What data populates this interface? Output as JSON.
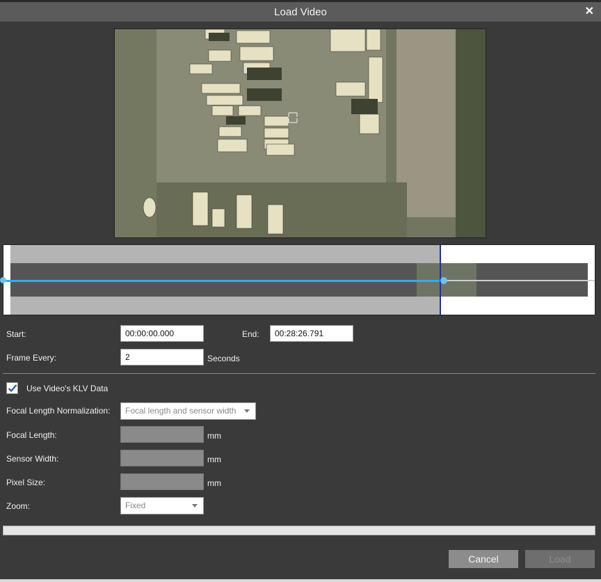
{
  "dialog": {
    "title": "Load Video",
    "close_label": "✕"
  },
  "form": {
    "start_label": "Start:",
    "start_value": "00:00:00.000",
    "end_label": "End:",
    "end_value": "00:28:26.791",
    "frame_every_label": "Frame Every:",
    "frame_every_value": "2",
    "frame_every_unit": "Seconds",
    "use_klv_label": "Use Video's KLV Data",
    "use_klv_checked": true,
    "focal_norm_label": "Focal Length Normalization:",
    "focal_norm_value": "Focal length and sensor width",
    "focal_length_label": "Focal Length:",
    "focal_length_unit": "mm",
    "sensor_width_label": "Sensor Width:",
    "sensor_width_unit": "mm",
    "pixel_size_label": "Pixel Size:",
    "pixel_size_unit": "mm",
    "zoom_label": "Zoom:",
    "zoom_value": "Fixed"
  },
  "timeline": {
    "position_fraction": 0.74,
    "range_end_fraction": 0.74
  },
  "progress": {
    "fraction": 0
  },
  "buttons": {
    "cancel": "Cancel",
    "load": "Load"
  },
  "colors": {
    "accent": "#31aee6",
    "cursor": "#1a2fb8",
    "title_bar": "#5b5b5b",
    "background": "#3a3a3a"
  }
}
